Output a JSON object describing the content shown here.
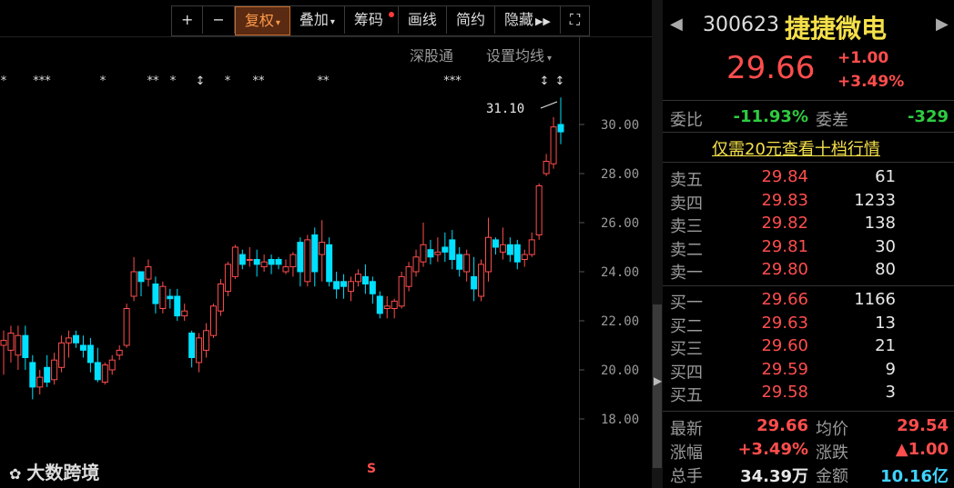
{
  "toolbar": {
    "plus": "+",
    "minus": "−",
    "fuquan": "复权",
    "diejia": "叠加",
    "chouma": "筹码",
    "huaxian": "画线",
    "jianyue": "简约",
    "yincang": "隐藏",
    "fullscreen": "⛶"
  },
  "subbar": {
    "shengutong": "深股通",
    "shezhi": "设置均线"
  },
  "chart": {
    "high_label": "31.10",
    "s_marker": "S",
    "watermark": "大数跨境"
  },
  "chart_data": {
    "type": "candlestick",
    "ylim": [
      17,
      32
    ],
    "yticks": [
      "30.00",
      "28.00",
      "26.00",
      "24.00",
      "22.00",
      "20.00",
      "18.00"
    ],
    "candles": [
      [
        21.0,
        21.2,
        19.8,
        21.6
      ],
      [
        20.8,
        21.5,
        20.3,
        21.8
      ],
      [
        20.6,
        21.4,
        20.0,
        21.8
      ],
      [
        21.4,
        20.5,
        20.0,
        21.8
      ],
      [
        20.3,
        19.3,
        18.8,
        20.6
      ],
      [
        19.3,
        19.7,
        19.0,
        20.0
      ],
      [
        20.1,
        19.5,
        19.3,
        20.6
      ],
      [
        19.6,
        20.4,
        19.4,
        20.7
      ],
      [
        20.1,
        21.1,
        19.9,
        21.4
      ],
      [
        21.1,
        21.3,
        20.5,
        21.6
      ],
      [
        21.4,
        21.1,
        20.9,
        21.6
      ],
      [
        21.0,
        20.8,
        20.5,
        21.4
      ],
      [
        21.0,
        20.3,
        19.9,
        21.3
      ],
      [
        20.3,
        19.6,
        19.5,
        20.9
      ],
      [
        19.5,
        20.2,
        19.4,
        20.3
      ],
      [
        20.0,
        20.4,
        19.8,
        20.6
      ],
      [
        20.6,
        20.8,
        20.4,
        21.0
      ],
      [
        21.0,
        22.5,
        20.9,
        22.7
      ],
      [
        23.0,
        24.0,
        22.8,
        24.6
      ],
      [
        24.0,
        23.6,
        23.0,
        24.0
      ],
      [
        23.7,
        24.2,
        23.4,
        24.5
      ],
      [
        23.5,
        22.7,
        22.3,
        23.8
      ],
      [
        22.5,
        23.4,
        22.3,
        23.6
      ],
      [
        23.0,
        22.9,
        22.5,
        23.3
      ],
      [
        23.0,
        22.2,
        22.0,
        23.3
      ],
      [
        22.2,
        22.4,
        22.0,
        22.7
      ],
      [
        21.5,
        20.5,
        20.1,
        21.6
      ],
      [
        20.3,
        21.3,
        19.9,
        21.5
      ],
      [
        20.8,
        21.6,
        20.5,
        21.9
      ],
      [
        21.4,
        22.6,
        21.3,
        22.7
      ],
      [
        22.4,
        23.5,
        22.2,
        23.7
      ],
      [
        23.2,
        24.3,
        23.0,
        24.4
      ],
      [
        23.8,
        25.0,
        23.7,
        25.1
      ],
      [
        24.7,
        24.3,
        24.1,
        24.9
      ],
      [
        24.5,
        24.5,
        24.2,
        25.0
      ],
      [
        24.5,
        24.3,
        23.8,
        24.9
      ],
      [
        24.2,
        24.4,
        24.0,
        24.7
      ],
      [
        24.5,
        24.3,
        23.9,
        24.7
      ],
      [
        24.5,
        24.3,
        24.1,
        24.6
      ],
      [
        24.0,
        24.2,
        23.9,
        24.5
      ],
      [
        24.2,
        24.7,
        23.8,
        24.8
      ],
      [
        25.2,
        24.0,
        23.4,
        25.4
      ],
      [
        23.6,
        25.3,
        23.4,
        25.5
      ],
      [
        25.5,
        24.0,
        23.4,
        25.8
      ],
      [
        24.7,
        25.2,
        23.6,
        26.1
      ],
      [
        25.1,
        23.6,
        23.4,
        25.4
      ],
      [
        23.6,
        23.3,
        22.9,
        24.0
      ],
      [
        23.6,
        23.4,
        22.9,
        23.9
      ],
      [
        23.2,
        23.6,
        22.8,
        23.8
      ],
      [
        23.6,
        23.9,
        23.4,
        24.1
      ],
      [
        23.8,
        23.5,
        23.1,
        24.3
      ],
      [
        23.6,
        23.1,
        22.7,
        23.8
      ],
      [
        23.0,
        22.3,
        22.1,
        23.2
      ],
      [
        22.5,
        22.6,
        22.1,
        23.0
      ],
      [
        22.5,
        22.8,
        22.1,
        22.9
      ],
      [
        22.6,
        23.8,
        22.5,
        24.0
      ],
      [
        23.4,
        24.2,
        23.2,
        24.4
      ],
      [
        24.0,
        24.6,
        23.8,
        24.9
      ],
      [
        24.4,
        25.1,
        24.2,
        26.0
      ],
      [
        24.9,
        24.6,
        24.3,
        25.3
      ],
      [
        24.7,
        24.8,
        24.4,
        25.4
      ],
      [
        25.0,
        24.8,
        24.4,
        25.6
      ],
      [
        25.3,
        24.5,
        24.1,
        25.7
      ],
      [
        24.7,
        24.1,
        23.8,
        25.0
      ],
      [
        24.0,
        24.7,
        23.6,
        24.9
      ],
      [
        23.8,
        23.3,
        22.8,
        24.6
      ],
      [
        23.0,
        24.3,
        22.8,
        24.5
      ],
      [
        24.0,
        25.4,
        23.6,
        26.2
      ],
      [
        25.3,
        25.0,
        24.7,
        25.4
      ],
      [
        24.8,
        25.1,
        24.5,
        25.8
      ],
      [
        25.1,
        24.7,
        24.4,
        25.4
      ],
      [
        25.1,
        24.4,
        24.1,
        25.3
      ],
      [
        24.5,
        24.7,
        24.2,
        24.9
      ],
      [
        24.7,
        25.3,
        24.6,
        25.6
      ],
      [
        25.5,
        27.5,
        25.3,
        27.6
      ],
      [
        28.0,
        28.5,
        27.9,
        28.8
      ],
      [
        28.4,
        29.9,
        28.2,
        30.3
      ],
      [
        30.0,
        29.7,
        29.2,
        31.1
      ]
    ]
  },
  "quote": {
    "code": "300623",
    "name": "捷捷微电",
    "price": "29.66",
    "change": "+1.00",
    "change_pct": "+3.49%",
    "weibi_label": "委比",
    "weibi": "-11.93%",
    "weicha_label": "委差",
    "weicha": "-329",
    "promo": "仅需20元查看十档行情"
  },
  "sell_orders": [
    {
      "label": "卖五",
      "price": "29.84",
      "vol": "61"
    },
    {
      "label": "卖四",
      "price": "29.83",
      "vol": "1233"
    },
    {
      "label": "卖三",
      "price": "29.82",
      "vol": "138"
    },
    {
      "label": "卖二",
      "price": "29.81",
      "vol": "30"
    },
    {
      "label": "卖一",
      "price": "29.80",
      "vol": "80"
    }
  ],
  "buy_orders": [
    {
      "label": "买一",
      "price": "29.66",
      "vol": "1166"
    },
    {
      "label": "买二",
      "price": "29.63",
      "vol": "13"
    },
    {
      "label": "买三",
      "price": "29.60",
      "vol": "21"
    },
    {
      "label": "买四",
      "price": "29.59",
      "vol": "9"
    },
    {
      "label": "买五",
      "price": "29.58",
      "vol": "3"
    }
  ],
  "stats": {
    "zuixin_label": "最新",
    "zuixin": "29.66",
    "junjia_label": "均价",
    "junjia": "29.54",
    "zhangfu_label": "涨幅",
    "zhangfu": "+3.49%",
    "zhangdie_label": "涨跌",
    "zhangdie": "▲1.00",
    "zongshou_label": "总手",
    "zongshou": "34.39万",
    "jine_label": "金额",
    "jine": "10.16亿"
  },
  "colors": {
    "up": "#ff4d4d",
    "down": "#00e0ff",
    "accent": "#ff9a4a"
  }
}
